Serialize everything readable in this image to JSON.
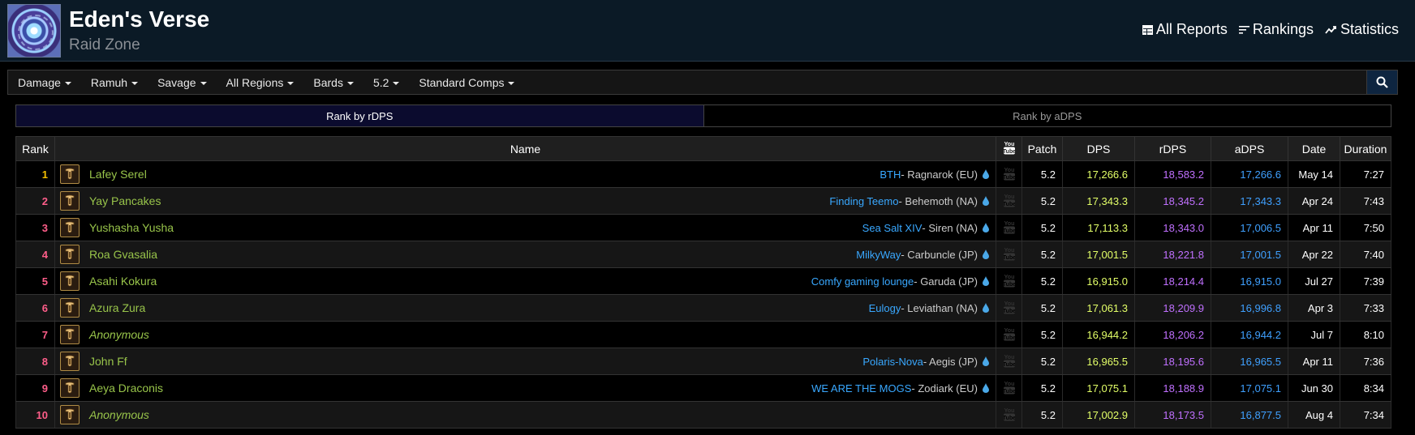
{
  "header": {
    "title": "Eden's Verse",
    "subtitle": "Raid Zone",
    "nav": [
      {
        "label": "All Reports",
        "icon": "table-icon"
      },
      {
        "label": "Rankings",
        "icon": "bars-icon"
      },
      {
        "label": "Statistics",
        "icon": "trend-icon"
      }
    ]
  },
  "filters": [
    "Damage",
    "Ramuh",
    "Savage",
    "All Regions",
    "Bards",
    "5.2",
    "Standard Comps"
  ],
  "tabs": {
    "active": "Rank by rDPS",
    "inactive": "Rank by aDPS"
  },
  "table": {
    "headers": {
      "rank": "Rank",
      "name": "Name",
      "patch": "Patch",
      "dps": "DPS",
      "rdps": "rDPS",
      "adps": "aDPS",
      "date": "Date",
      "duration": "Duration"
    },
    "rows": [
      {
        "rank": "1",
        "name": "Lafey Serel",
        "guild": "BTH",
        "server": " - Ragnarok (EU)",
        "patch": "5.2",
        "dps": "17,266.6",
        "rdps": "18,583.2",
        "adps": "17,266.6",
        "date": "May 14",
        "duration": "7:27"
      },
      {
        "rank": "2",
        "name": "Yay Pancakes",
        "guild": "Finding Teemo",
        "server": " - Behemoth (NA)",
        "patch": "5.2",
        "dps": "17,343.3",
        "rdps": "18,345.2",
        "adps": "17,343.3",
        "date": "Apr 24",
        "duration": "7:43"
      },
      {
        "rank": "3",
        "name": "Yushasha Yusha",
        "guild": "Sea Salt XIV",
        "server": " - Siren (NA)",
        "patch": "5.2",
        "dps": "17,113.3",
        "rdps": "18,343.0",
        "adps": "17,006.5",
        "date": "Apr 11",
        "duration": "7:50"
      },
      {
        "rank": "4",
        "name": "Roa Gvasalia",
        "guild": "MilkyWay",
        "server": " - Carbuncle (JP)",
        "patch": "5.2",
        "dps": "17,001.5",
        "rdps": "18,221.8",
        "adps": "17,001.5",
        "date": "Apr 22",
        "duration": "7:40"
      },
      {
        "rank": "5",
        "name": "Asahi Kokura",
        "guild": "Comfy gaming lounge",
        "server": " - Garuda (JP)",
        "patch": "5.2",
        "dps": "16,915.0",
        "rdps": "18,214.4",
        "adps": "16,915.0",
        "date": "Jul 27",
        "duration": "7:39"
      },
      {
        "rank": "6",
        "name": "Azura Zura",
        "guild": "Eulogy",
        "server": " - Leviathan (NA)",
        "patch": "5.2",
        "dps": "17,061.3",
        "rdps": "18,209.9",
        "adps": "16,996.8",
        "date": "Apr 3",
        "duration": "7:33"
      },
      {
        "rank": "7",
        "name": "Anonymous",
        "guild": "",
        "server": "",
        "patch": "5.2",
        "dps": "16,944.2",
        "rdps": "18,206.2",
        "adps": "16,944.2",
        "date": "Jul 7",
        "duration": "8:10"
      },
      {
        "rank": "8",
        "name": "John Ff",
        "guild": "Polaris-Nova",
        "server": " - Aegis (JP)",
        "patch": "5.2",
        "dps": "16,965.5",
        "rdps": "18,195.6",
        "adps": "16,965.5",
        "date": "Apr 11",
        "duration": "7:36"
      },
      {
        "rank": "9",
        "name": "Aeya Draconis",
        "guild": "WE ARE THE MOGS",
        "server": " - Zodiark (EU)",
        "patch": "5.2",
        "dps": "17,075.1",
        "rdps": "18,188.9",
        "adps": "17,075.1",
        "date": "Jun 30",
        "duration": "8:34"
      },
      {
        "rank": "10",
        "name": "Anonymous",
        "guild": "",
        "server": "",
        "patch": "5.2",
        "dps": "17,002.9",
        "rdps": "18,173.5",
        "adps": "16,877.5",
        "date": "Aug 4",
        "duration": "7:34"
      }
    ]
  },
  "colors": {
    "dps": "#e3ff68",
    "rdps": "#c070ff",
    "adps": "#3fa0ff",
    "rank_top": "#f5c000",
    "rank": "#ff5e8a",
    "player": "#98c44a",
    "guild": "#39a8ff"
  }
}
